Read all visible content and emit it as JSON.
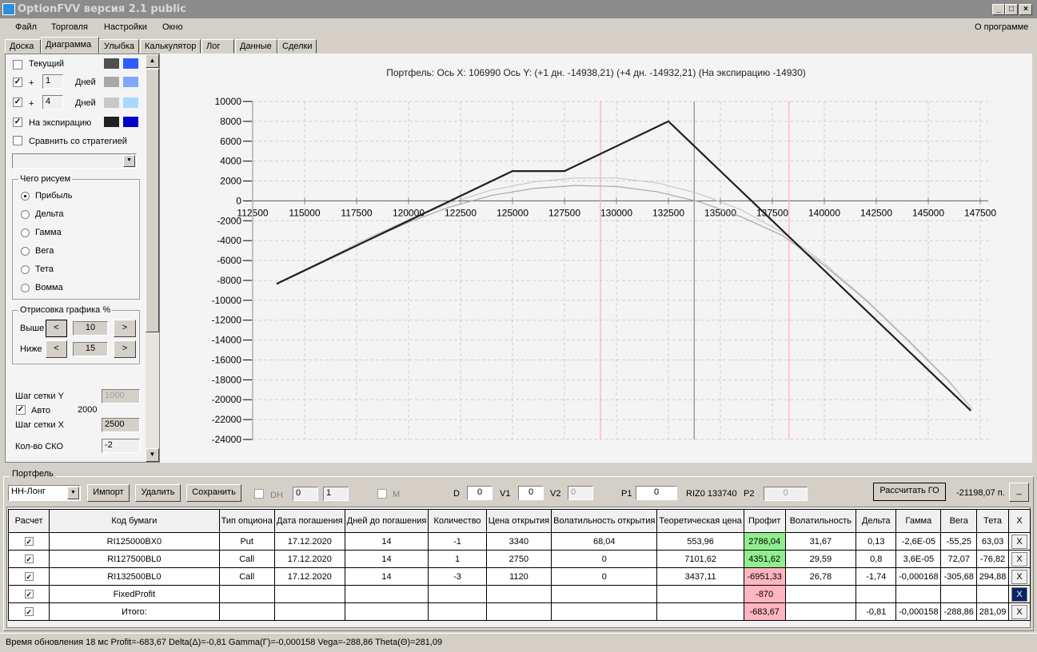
{
  "window": {
    "title": "OptionFVV версия 2.1 public",
    "min": "_",
    "max": "□",
    "close": "×"
  },
  "menu": {
    "items": [
      "Файл",
      "Торговля",
      "Настройки",
      "Окно"
    ],
    "about": "О программе"
  },
  "tabs": [
    "Доска",
    "Диаграмма",
    "Улыбка",
    "Калькулятор",
    "Лог",
    "Данные",
    "Сделки"
  ],
  "active_tab": "Диаграмма",
  "left": {
    "current": {
      "label": "Текущий",
      "checked": false,
      "colors": [
        "#505050",
        "#2f5cff"
      ]
    },
    "plus1": {
      "plus": "+",
      "value": "1",
      "unit": "Дней",
      "checked": true,
      "colors": [
        "#a8a8a8",
        "#7fa8ff"
      ]
    },
    "plus4": {
      "plus": "+",
      "value": "4",
      "unit": "Дней",
      "checked": true,
      "colors": [
        "#c8c8c8",
        "#a8d8ff"
      ]
    },
    "expiry": {
      "label": "На экспирацию",
      "checked": true,
      "colors": [
        "#202020",
        "#0000c8"
      ]
    },
    "compare": {
      "label": "Сравнить со стратегией",
      "checked": false
    },
    "draw_group": {
      "title": "Чего рисуем",
      "options": [
        "Прибыль",
        "Дельта",
        "Гамма",
        "Вега",
        "Тета",
        "Вомма"
      ],
      "selected": "Прибыль"
    },
    "render_group": {
      "title": "Отрисовка графика %",
      "above_label": "Выше",
      "above": "10",
      "below_label": "Ниже",
      "below": "15",
      "dec": "<",
      "inc": ">"
    },
    "grid_y_label": "Шаг сетки Y",
    "grid_y": "1000",
    "auto_label": "Авто",
    "auto_checked": true,
    "auto_value": "2000",
    "grid_x_label": "Шаг сетки X",
    "grid_x": "2500",
    "sko_label": "Кол-во СКО",
    "sko": "-2"
  },
  "chart_data": {
    "type": "line",
    "title": "Портфель: Ось X:  106990 Ось Y:   (+1 дн. -14938,21)  (+4 дн. -14932,21)  (На экспирацию -14930)",
    "xlim": [
      112500,
      147500
    ],
    "ylim": [
      -24000,
      10000
    ],
    "x_ticks": [
      112500,
      115000,
      117500,
      120000,
      122500,
      125000,
      127500,
      130000,
      132500,
      135000,
      137500,
      140000,
      142500,
      145000,
      147500
    ],
    "y_ticks": [
      10000,
      8000,
      6000,
      4000,
      2000,
      0,
      -2000,
      -4000,
      -6000,
      -8000,
      -10000,
      -12000,
      -14000,
      -16000,
      -18000,
      -20000,
      -22000,
      -24000
    ],
    "grid": true,
    "vlines": [
      {
        "x": 129230,
        "color": "#ffb0b8"
      },
      {
        "x": 133740,
        "color": "#8090a8"
      },
      {
        "x": 138300,
        "color": "#ffb0b8"
      }
    ],
    "series": [
      {
        "key": "+1",
        "color": "#a8a8a8",
        "points": [
          [
            113700,
            -8300
          ],
          [
            116000,
            -6000
          ],
          [
            118000,
            -4000
          ],
          [
            120000,
            -2150
          ],
          [
            122000,
            -600
          ],
          [
            124000,
            550
          ],
          [
            126000,
            1250
          ],
          [
            128000,
            1550
          ],
          [
            130000,
            1450
          ],
          [
            132000,
            900
          ],
          [
            134000,
            -100
          ],
          [
            136000,
            -1600
          ],
          [
            138000,
            -3500
          ],
          [
            140000,
            -6500
          ],
          [
            142000,
            -10000
          ],
          [
            144000,
            -14000
          ],
          [
            146000,
            -18200
          ],
          [
            147100,
            -20900
          ]
        ]
      },
      {
        "key": "+4",
        "color": "#c8c8c8",
        "points": [
          [
            113700,
            -8250
          ],
          [
            116000,
            -5900
          ],
          [
            118000,
            -3800
          ],
          [
            120000,
            -1900
          ],
          [
            122000,
            -200
          ],
          [
            124000,
            1100
          ],
          [
            126000,
            1900
          ],
          [
            128000,
            2300
          ],
          [
            130000,
            2300
          ],
          [
            132000,
            1800
          ],
          [
            134000,
            700
          ],
          [
            136000,
            -900
          ],
          [
            138000,
            -3200
          ],
          [
            140000,
            -6300
          ],
          [
            142000,
            -9900
          ],
          [
            144000,
            -13900
          ],
          [
            146000,
            -18100
          ],
          [
            147100,
            -20900
          ]
        ]
      },
      {
        "key": "expiry",
        "color": "#202020",
        "points": [
          [
            113650,
            -8350
          ],
          [
            125000,
            3000
          ],
          [
            127500,
            3000
          ],
          [
            132500,
            8000
          ],
          [
            147050,
            -21100
          ]
        ]
      }
    ]
  },
  "portfolio": {
    "title": "Портфель",
    "select": "НН-Лонг",
    "import": "Импорт",
    "delete": "Удалить",
    "save": "Сохранить",
    "dh_label": "DH",
    "spin1": "0",
    "spin2": "1",
    "m_label": "M",
    "d_label": "D",
    "d": "0",
    "v1_label": "V1",
    "v1": "0",
    "v2_label": "V2",
    "v2": "0",
    "p1_label": "P1",
    "p1": "0",
    "riz": "RIZ0 133740",
    "p2_label": "P2",
    "p2": "0",
    "calc_go": "Рассчитать ГО",
    "go_value": "-21198,07 п.",
    "minimize": "_",
    "columns": [
      "Расчет",
      "Код бумаги",
      "Тип опциона",
      "Дата погашения",
      "Дней до погашения",
      "Количество",
      "Цена открытия",
      "Волатильность открытия",
      "Теоретическая цена",
      "Профит",
      "Волатильность",
      "Дельта",
      "Гамма",
      "Вега",
      "Тета",
      "X"
    ],
    "rows": [
      {
        "calc": true,
        "code": "RI125000BX0",
        "type": "Put",
        "date": "17.12.2020",
        "days": "14",
        "qty": "-1",
        "open": "3340",
        "vol_open": "68,04",
        "theo": "553,96",
        "profit": "2786,04",
        "profit_color": "#90ee90",
        "vol": "31,67",
        "delta": "0,13",
        "gamma": "-2,6E-05",
        "vega": "-55,25",
        "theta": "63,03",
        "x": "X"
      },
      {
        "calc": true,
        "code": "RI127500BL0",
        "type": "Call",
        "date": "17.12.2020",
        "days": "14",
        "qty": "1",
        "open": "2750",
        "vol_open": "0",
        "theo": "7101,62",
        "profit": "4351,62",
        "profit_color": "#90ee90",
        "vol": "29,59",
        "delta": "0,8",
        "gamma": "3,6E-05",
        "vega": "72,07",
        "theta": "-76,82",
        "x": "X"
      },
      {
        "calc": true,
        "code": "RI132500BL0",
        "type": "Call",
        "date": "17.12.2020",
        "days": "14",
        "qty": "-3",
        "open": "1120",
        "vol_open": "0",
        "theo": "3437,11",
        "profit": "-6951,33",
        "profit_color": "#ffb6c1",
        "vol": "26,78",
        "delta": "-1,74",
        "gamma": "-0,000168",
        "vega": "-305,68",
        "theta": "294,88",
        "x": "X"
      },
      {
        "calc": true,
        "code": "FixedProfit",
        "type": "",
        "date": "",
        "days": "",
        "qty": "",
        "open": "",
        "vol_open": "",
        "theo": "",
        "profit": "-870",
        "profit_color": "#ffb6c1",
        "vol": "",
        "delta": "",
        "gamma": "",
        "vega": "",
        "theta": "",
        "x": "X",
        "x_selected": true
      },
      {
        "calc": true,
        "code": "Итого:",
        "type": "",
        "date": "",
        "days": "",
        "qty": "",
        "open": "",
        "vol_open": "",
        "theo": "",
        "profit": "-683,67",
        "profit_color": "#ffb6c1",
        "vol": "",
        "delta": "-0,81",
        "gamma": "-0,000158",
        "vega": "-288,86",
        "theta": "281,09",
        "x": "X"
      }
    ]
  },
  "status": "Время обновления 18 мс  Profit=-683,67 Delta(Δ)=-0,81 Gamma(Γ)=-0,000158 Vega=-288,86 Theta(Θ)=281,09"
}
